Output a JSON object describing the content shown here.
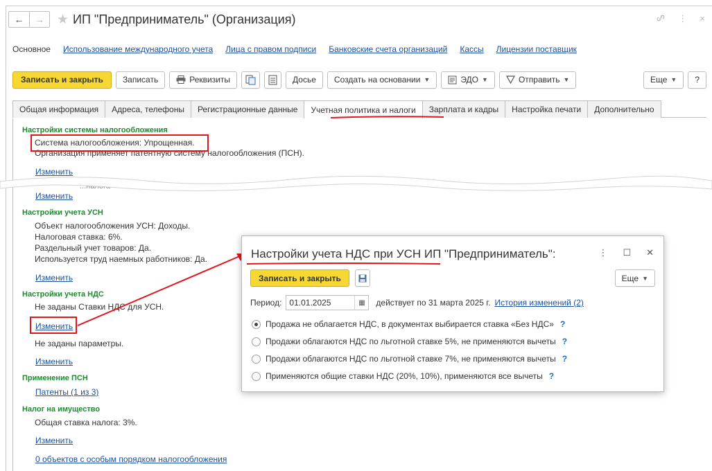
{
  "window": {
    "title": "ИП \"Предприниматель\" (Организация)",
    "back_icon": "←",
    "forward_icon": "→",
    "star_icon": "★",
    "link_icon": "🔗",
    "more_icon": "⋮",
    "close_icon": "×"
  },
  "sections": {
    "main": "Основное",
    "links": [
      "Использование международного учета",
      "Лица с правом подписи",
      "Банковские счета организаций",
      "Кассы",
      "Лицензии поставщик"
    ]
  },
  "toolbar": {
    "save_close": "Записать и закрыть",
    "save": "Записать",
    "requisites": "Реквизиты",
    "dossier": "Досье",
    "create_based": "Создать на основании",
    "edo": "ЭДО",
    "send": "Отправить",
    "more": "Еще",
    "help": "?"
  },
  "tabs": [
    "Общая информация",
    "Адреса, телефоны",
    "Регистрационные данные",
    "Учетная политика и налоги",
    "Зарплата и кадры",
    "Настройка печати",
    "Дополнительно"
  ],
  "active_tab": 3,
  "tax_system": {
    "header": "Настройки системы налогообложения",
    "system": "Система налогообложения: Упрощенная.",
    "patent": "Организация применяет патентную систему налогообложения (ПСН).",
    "change": "Изменить",
    "hidden_fragment": "...налога",
    "change2": "Изменить"
  },
  "usn": {
    "header": "Настройки учета УСН",
    "object": "Объект налогообложения УСН: Доходы.",
    "rate": "Налоговая ставка: 6%.",
    "separate": "Раздельный учет товаров: Да.",
    "workers": "Используется труд наемных работников: Да.",
    "change": "Изменить"
  },
  "vat": {
    "header": "Настройки учета НДС",
    "not_set": "Не заданы Ставки НДС для УСН.",
    "change": "Изменить",
    "params": "Не заданы параметры.",
    "change2": "Изменить"
  },
  "psn": {
    "header": "Применение ПСН",
    "patents": "Патенты (1 из 3)"
  },
  "property": {
    "header": "Налог на имущество",
    "rate": "Общая ставка налога: 3%.",
    "change": "Изменить",
    "special": "0 объектов с особым порядком налогообложения"
  },
  "modal": {
    "title": "Настройки учета НДС при УСН ИП \"Предприниматель\":",
    "save_close": "Записать и закрыть",
    "more": "Еще",
    "period_label": "Период:",
    "period_value": "01.01.2025",
    "valid_until": "действует по 31 марта 2025 г.",
    "history": "История изменений (2)",
    "options": [
      "Продажа не облагается НДС, в документах выбирается ставка «Без НДС»",
      "Продажи облагаются НДС по льготной ставке 5%, не применяются вычеты",
      "Продажи облагаются НДС по льготной ставке 7%, не применяются вычеты",
      "Применяются общие ставки НДС (20%, 10%), применяются все вычеты"
    ],
    "selected_option": 0,
    "help": "?"
  },
  "colors": {
    "accent_yellow": "#f7d832",
    "link_blue": "#1a4f9c",
    "group_green": "#1e8a2f",
    "annotation_red": "#e3141c"
  }
}
